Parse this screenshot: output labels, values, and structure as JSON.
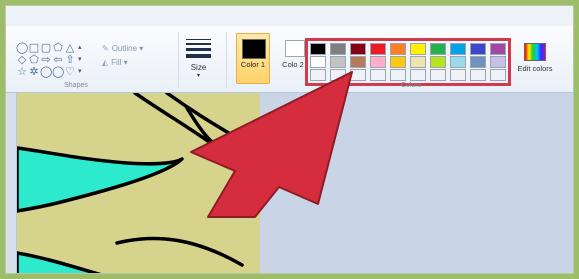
{
  "ribbon": {
    "shapes_group_label": "Shapes",
    "colors_group_label": "Colors",
    "outline_label": "Outline",
    "fill_label": "Fill",
    "size_label": "Size",
    "color1_label": "Color 1",
    "color2_label": "Colo 2",
    "edit_colors_label": "Edit colors"
  },
  "colors": {
    "color1": "#000000",
    "color2": "#ffffff",
    "highlight_border": "#d03a4c",
    "pointer_arrow": "#d62d3e",
    "canvas_background": "#d6d48c",
    "shape_fill": "#2eeacc"
  },
  "palette": {
    "row1": [
      "#000000",
      "#7f7f7f",
      "#880015",
      "#ed1c24",
      "#ff7f27",
      "#fff200",
      "#22b14c",
      "#00a2e8",
      "#3f48cc",
      "#a349a4"
    ],
    "row2": [
      "#ffffff",
      "#c3c3c3",
      "#b97a57",
      "#ffaec9",
      "#ffc90e",
      "#efe4b0",
      "#b5e61d",
      "#99d9ea",
      "#7092be",
      "#c8bfe7"
    ],
    "row3": [
      "#eef2f8",
      "#eef2f8",
      "#eef2f8",
      "#eef2f8",
      "#eef2f8",
      "#eef2f8",
      "#eef2f8",
      "#eef2f8",
      "#eef2f8",
      "#eef2f8"
    ]
  },
  "shape_icons": [
    "oval-icon",
    "rectangle-icon",
    "rounded-rectangle-icon",
    "polygon-icon",
    "triangle-icon",
    "diamond-icon",
    "pentagon-icon",
    "right-arrow-icon",
    "left-arrow-icon",
    "up-arrow-icon",
    "star-icon",
    "burst-icon",
    "speech-bubble-icon",
    "callout-icon",
    "heart-icon"
  ]
}
